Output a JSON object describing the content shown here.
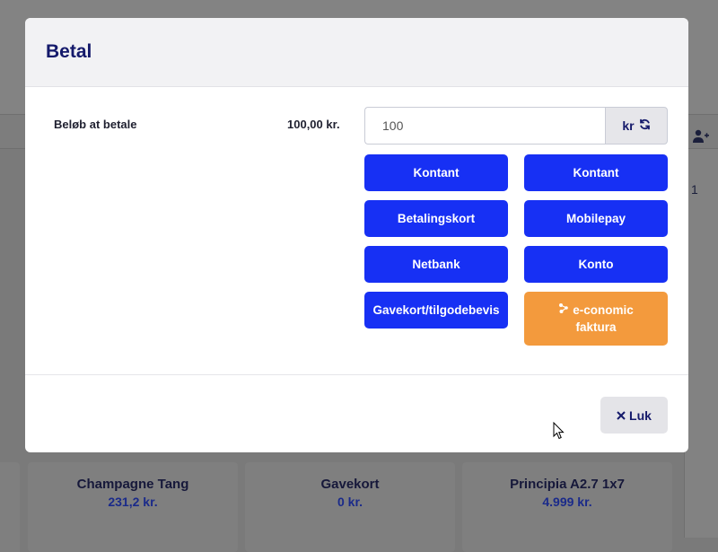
{
  "background": {
    "row_number": "1",
    "cards": [
      {
        "name": "Champagne Tang",
        "price": "231,2 kr."
      },
      {
        "name": "Gavekort",
        "price": "0 kr."
      },
      {
        "name": "Principia A2.7 1x7",
        "price": "4.999 kr."
      }
    ]
  },
  "modal": {
    "title": "Betal",
    "amount_label": "Beløb at betale",
    "amount_value": "100,00 kr.",
    "amount_input": {
      "value": "100",
      "placeholder": ""
    },
    "currency_label": "kr",
    "buttons": {
      "kontant_1": "Kontant",
      "kontant_2": "Kontant",
      "betalingskort": "Betalingskort",
      "mobilepay": "Mobilepay",
      "netbank": "Netbank",
      "konto": "Konto",
      "gavekort": "Gavekort/tilgodebevis",
      "economic": "e-conomic faktura"
    },
    "close_label": "Luk"
  },
  "colors": {
    "primary": "#1730f4",
    "accent_orange": "#f39a3d",
    "title": "#151a6b"
  }
}
